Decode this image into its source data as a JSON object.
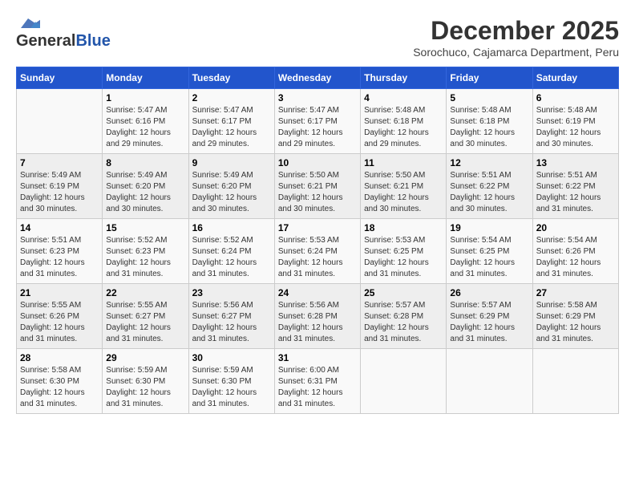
{
  "header": {
    "logo_general": "General",
    "logo_blue": "Blue",
    "month_title": "December 2025",
    "subtitle": "Sorochuco, Cajamarca Department, Peru"
  },
  "days_of_week": [
    "Sunday",
    "Monday",
    "Tuesday",
    "Wednesday",
    "Thursday",
    "Friday",
    "Saturday"
  ],
  "weeks": [
    [
      {
        "day": "",
        "sunrise": "",
        "sunset": "",
        "daylight": ""
      },
      {
        "day": "1",
        "sunrise": "Sunrise: 5:47 AM",
        "sunset": "Sunset: 6:16 PM",
        "daylight": "Daylight: 12 hours and 29 minutes."
      },
      {
        "day": "2",
        "sunrise": "Sunrise: 5:47 AM",
        "sunset": "Sunset: 6:17 PM",
        "daylight": "Daylight: 12 hours and 29 minutes."
      },
      {
        "day": "3",
        "sunrise": "Sunrise: 5:47 AM",
        "sunset": "Sunset: 6:17 PM",
        "daylight": "Daylight: 12 hours and 29 minutes."
      },
      {
        "day": "4",
        "sunrise": "Sunrise: 5:48 AM",
        "sunset": "Sunset: 6:18 PM",
        "daylight": "Daylight: 12 hours and 29 minutes."
      },
      {
        "day": "5",
        "sunrise": "Sunrise: 5:48 AM",
        "sunset": "Sunset: 6:18 PM",
        "daylight": "Daylight: 12 hours and 30 minutes."
      },
      {
        "day": "6",
        "sunrise": "Sunrise: 5:48 AM",
        "sunset": "Sunset: 6:19 PM",
        "daylight": "Daylight: 12 hours and 30 minutes."
      }
    ],
    [
      {
        "day": "7",
        "sunrise": "Sunrise: 5:49 AM",
        "sunset": "Sunset: 6:19 PM",
        "daylight": "Daylight: 12 hours and 30 minutes."
      },
      {
        "day": "8",
        "sunrise": "Sunrise: 5:49 AM",
        "sunset": "Sunset: 6:20 PM",
        "daylight": "Daylight: 12 hours and 30 minutes."
      },
      {
        "day": "9",
        "sunrise": "Sunrise: 5:49 AM",
        "sunset": "Sunset: 6:20 PM",
        "daylight": "Daylight: 12 hours and 30 minutes."
      },
      {
        "day": "10",
        "sunrise": "Sunrise: 5:50 AM",
        "sunset": "Sunset: 6:21 PM",
        "daylight": "Daylight: 12 hours and 30 minutes."
      },
      {
        "day": "11",
        "sunrise": "Sunrise: 5:50 AM",
        "sunset": "Sunset: 6:21 PM",
        "daylight": "Daylight: 12 hours and 30 minutes."
      },
      {
        "day": "12",
        "sunrise": "Sunrise: 5:51 AM",
        "sunset": "Sunset: 6:22 PM",
        "daylight": "Daylight: 12 hours and 30 minutes."
      },
      {
        "day": "13",
        "sunrise": "Sunrise: 5:51 AM",
        "sunset": "Sunset: 6:22 PM",
        "daylight": "Daylight: 12 hours and 31 minutes."
      }
    ],
    [
      {
        "day": "14",
        "sunrise": "Sunrise: 5:51 AM",
        "sunset": "Sunset: 6:23 PM",
        "daylight": "Daylight: 12 hours and 31 minutes."
      },
      {
        "day": "15",
        "sunrise": "Sunrise: 5:52 AM",
        "sunset": "Sunset: 6:23 PM",
        "daylight": "Daylight: 12 hours and 31 minutes."
      },
      {
        "day": "16",
        "sunrise": "Sunrise: 5:52 AM",
        "sunset": "Sunset: 6:24 PM",
        "daylight": "Daylight: 12 hours and 31 minutes."
      },
      {
        "day": "17",
        "sunrise": "Sunrise: 5:53 AM",
        "sunset": "Sunset: 6:24 PM",
        "daylight": "Daylight: 12 hours and 31 minutes."
      },
      {
        "day": "18",
        "sunrise": "Sunrise: 5:53 AM",
        "sunset": "Sunset: 6:25 PM",
        "daylight": "Daylight: 12 hours and 31 minutes."
      },
      {
        "day": "19",
        "sunrise": "Sunrise: 5:54 AM",
        "sunset": "Sunset: 6:25 PM",
        "daylight": "Daylight: 12 hours and 31 minutes."
      },
      {
        "day": "20",
        "sunrise": "Sunrise: 5:54 AM",
        "sunset": "Sunset: 6:26 PM",
        "daylight": "Daylight: 12 hours and 31 minutes."
      }
    ],
    [
      {
        "day": "21",
        "sunrise": "Sunrise: 5:55 AM",
        "sunset": "Sunset: 6:26 PM",
        "daylight": "Daylight: 12 hours and 31 minutes."
      },
      {
        "day": "22",
        "sunrise": "Sunrise: 5:55 AM",
        "sunset": "Sunset: 6:27 PM",
        "daylight": "Daylight: 12 hours and 31 minutes."
      },
      {
        "day": "23",
        "sunrise": "Sunrise: 5:56 AM",
        "sunset": "Sunset: 6:27 PM",
        "daylight": "Daylight: 12 hours and 31 minutes."
      },
      {
        "day": "24",
        "sunrise": "Sunrise: 5:56 AM",
        "sunset": "Sunset: 6:28 PM",
        "daylight": "Daylight: 12 hours and 31 minutes."
      },
      {
        "day": "25",
        "sunrise": "Sunrise: 5:57 AM",
        "sunset": "Sunset: 6:28 PM",
        "daylight": "Daylight: 12 hours and 31 minutes."
      },
      {
        "day": "26",
        "sunrise": "Sunrise: 5:57 AM",
        "sunset": "Sunset: 6:29 PM",
        "daylight": "Daylight: 12 hours and 31 minutes."
      },
      {
        "day": "27",
        "sunrise": "Sunrise: 5:58 AM",
        "sunset": "Sunset: 6:29 PM",
        "daylight": "Daylight: 12 hours and 31 minutes."
      }
    ],
    [
      {
        "day": "28",
        "sunrise": "Sunrise: 5:58 AM",
        "sunset": "Sunset: 6:30 PM",
        "daylight": "Daylight: 12 hours and 31 minutes."
      },
      {
        "day": "29",
        "sunrise": "Sunrise: 5:59 AM",
        "sunset": "Sunset: 6:30 PM",
        "daylight": "Daylight: 12 hours and 31 minutes."
      },
      {
        "day": "30",
        "sunrise": "Sunrise: 5:59 AM",
        "sunset": "Sunset: 6:30 PM",
        "daylight": "Daylight: 12 hours and 31 minutes."
      },
      {
        "day": "31",
        "sunrise": "Sunrise: 6:00 AM",
        "sunset": "Sunset: 6:31 PM",
        "daylight": "Daylight: 12 hours and 31 minutes."
      },
      {
        "day": "",
        "sunrise": "",
        "sunset": "",
        "daylight": ""
      },
      {
        "day": "",
        "sunrise": "",
        "sunset": "",
        "daylight": ""
      },
      {
        "day": "",
        "sunrise": "",
        "sunset": "",
        "daylight": ""
      }
    ]
  ]
}
